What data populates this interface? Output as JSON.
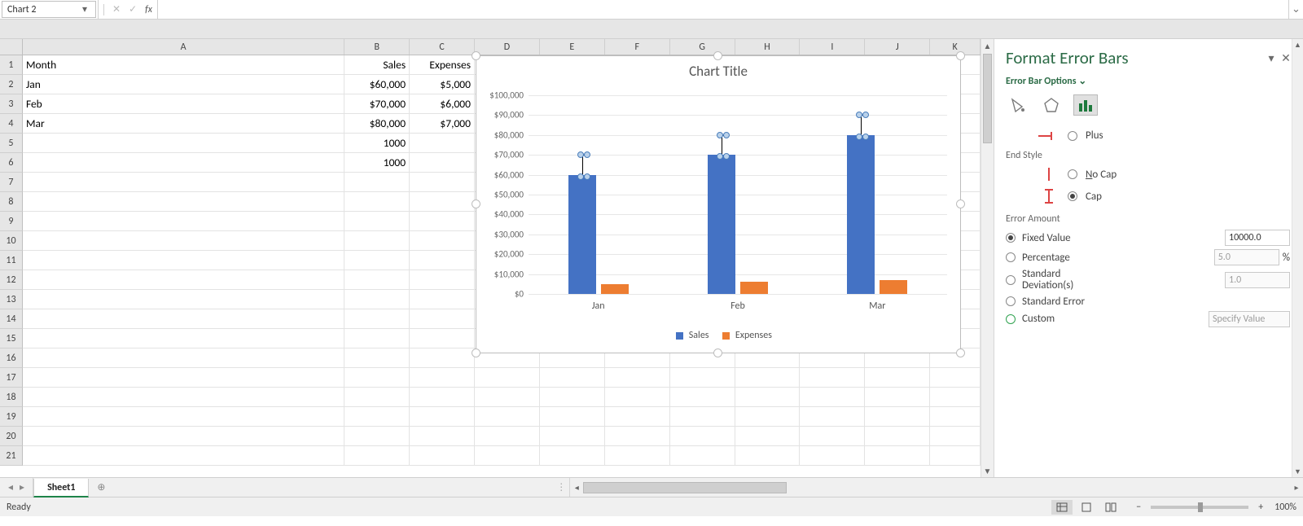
{
  "name_box": "Chart 2",
  "sheet": {
    "columns": [
      "A",
      "B",
      "C",
      "D",
      "E",
      "F",
      "G",
      "H",
      "I",
      "J",
      "K"
    ],
    "rows": 21,
    "data": {
      "1": {
        "A": "Month",
        "B": "Sales",
        "C": "Expenses"
      },
      "2": {
        "A": "Jan",
        "B": "$60,000",
        "C": "$5,000"
      },
      "3": {
        "A": "Feb",
        "B": "$70,000",
        "C": "$6,000"
      },
      "4": {
        "A": "Mar",
        "B": "$80,000",
        "C": "$7,000"
      },
      "5": {
        "B": "1000"
      },
      "6": {
        "B": "1000"
      }
    },
    "tab_name": "Sheet1"
  },
  "chart_data": {
    "type": "bar",
    "title": "Chart Title",
    "categories": [
      "Jan",
      "Feb",
      "Mar"
    ],
    "series": [
      {
        "name": "Sales",
        "values": [
          60000,
          70000,
          80000
        ],
        "color": "#4472c4"
      },
      {
        "name": "Expenses",
        "values": [
          5000,
          6000,
          7000
        ],
        "color": "#ed7d31"
      }
    ],
    "yticks": [
      "$0",
      "$10,000",
      "$20,000",
      "$30,000",
      "$40,000",
      "$50,000",
      "$60,000",
      "$70,000",
      "$80,000",
      "$90,000",
      "$100,000"
    ],
    "ylim": [
      0,
      100000
    ],
    "error_bars": {
      "series": "Sales",
      "direction": "plus",
      "cap": true,
      "fixed_value": 10000
    }
  },
  "pane": {
    "title": "Format Error Bars",
    "menu": "Error Bar Options",
    "direction": {
      "plus": "Plus"
    },
    "end_style": {
      "label": "End Style",
      "no_cap": "No Cap",
      "cap": "Cap",
      "selected": "cap"
    },
    "error_amount": {
      "label": "Error Amount",
      "fixed_value_label": "Fixed Value",
      "fixed_value": "10000.0",
      "fixed_selected": true,
      "percentage_label": "Percentage",
      "percentage": "5.0",
      "percentage_unit": "%",
      "stddev_label": "Standard Deviation(s)",
      "stddev": "1.0",
      "stderr_label": "Standard Error",
      "custom_label": "Custom",
      "custom_button": "Specify Value"
    }
  },
  "status": {
    "left": "Ready",
    "zoom": "100%"
  }
}
